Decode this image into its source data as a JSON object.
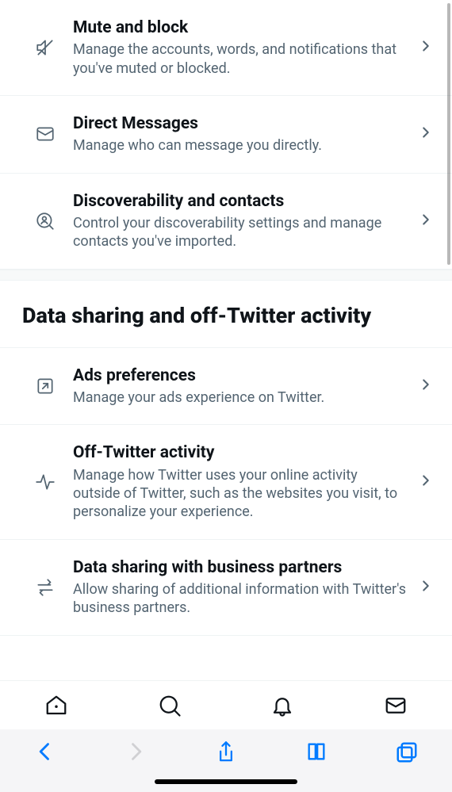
{
  "section1": {
    "items": [
      {
        "title": "Mute and block",
        "desc": "Manage the accounts, words, and notifications that you've muted or blocked."
      },
      {
        "title": "Direct Messages",
        "desc": "Manage who can message you directly."
      },
      {
        "title": "Discoverability and contacts",
        "desc": "Control your discoverability settings and manage contacts you've imported."
      }
    ]
  },
  "section2": {
    "header": "Data sharing and off-Twitter activity",
    "items": [
      {
        "title": "Ads preferences",
        "desc": "Manage your ads experience on Twitter."
      },
      {
        "title": "Off-Twitter activity",
        "desc": "Manage how Twitter uses your online activity outside of Twitter, such as the websites you visit, to personalize your experience."
      },
      {
        "title": "Data sharing with business partners",
        "desc": "Allow sharing of additional information with Twitter's business partners."
      }
    ]
  }
}
